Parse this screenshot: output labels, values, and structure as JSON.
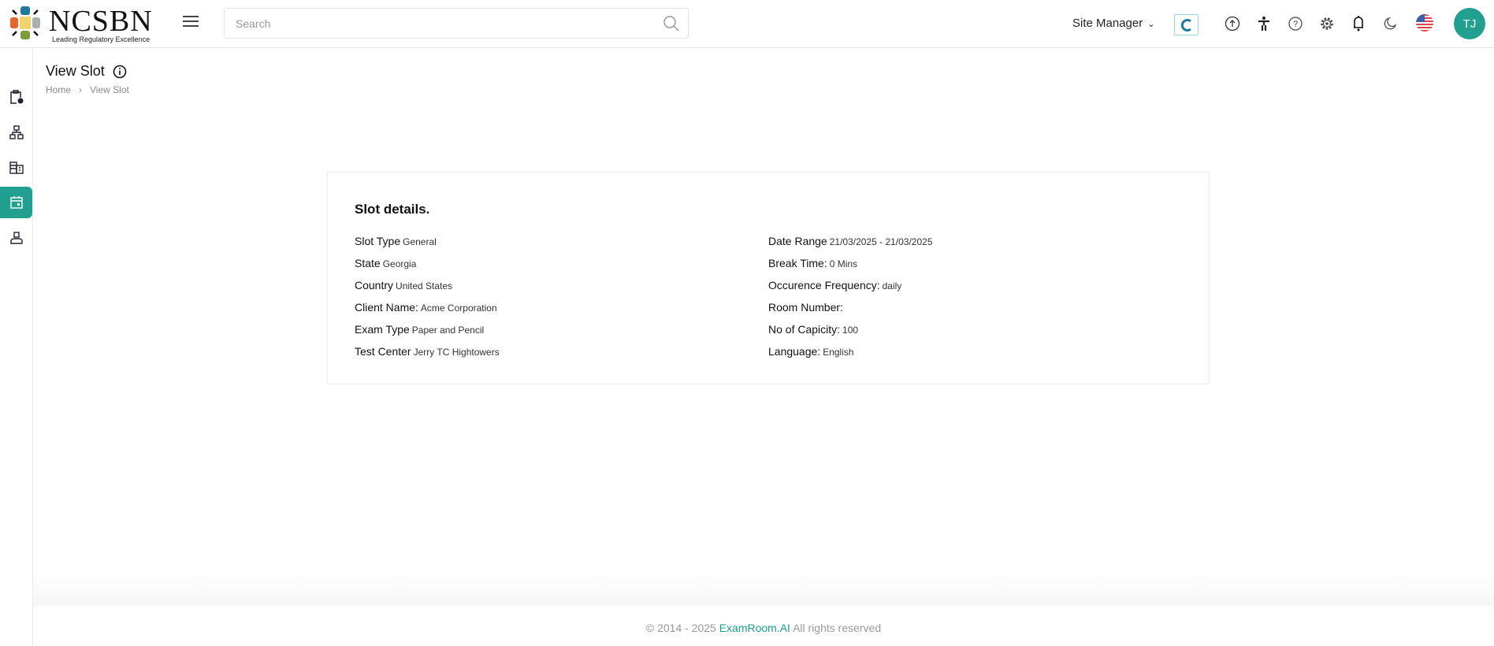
{
  "header": {
    "logo_text": "NCSBN",
    "logo_tagline": "Leading Regulatory Excellence",
    "search_placeholder": "Search",
    "role": "Site Manager",
    "avatar_initials": "TJ",
    "accent": "#22a08f"
  },
  "sidebar": {
    "items": [
      {
        "name": "clipboard-clock"
      },
      {
        "name": "sitemap"
      },
      {
        "name": "building"
      },
      {
        "name": "calendar",
        "active": true
      },
      {
        "name": "user-badge"
      }
    ]
  },
  "page": {
    "title": "View Slot",
    "breadcrumb": [
      "Home",
      "View Slot"
    ]
  },
  "card": {
    "title": "Slot details.",
    "left": [
      {
        "label": "Slot Type",
        "value": "General"
      },
      {
        "label": "State",
        "value": "Georgia"
      },
      {
        "label": "Country",
        "value": "United States"
      },
      {
        "label": "Client Name:",
        "value": "Acme Corporation"
      },
      {
        "label": "Exam Type",
        "value": "Paper and Pencil"
      },
      {
        "label": "Test Center",
        "value": "Jerry TC Hightowers"
      }
    ],
    "right": [
      {
        "label": "Date Range",
        "value": "21/03/2025 - 21/03/2025"
      },
      {
        "label": "Break Time:",
        "value": "0 Mins"
      },
      {
        "label": "Occurence Frequency:",
        "value": "daily"
      },
      {
        "label": "Room Number:",
        "value": ""
      },
      {
        "label": "No of Capicity:",
        "value": "100"
      },
      {
        "label": "Language:",
        "value": "English"
      }
    ]
  },
  "footer": {
    "prefix": "© 2014 - 2025",
    "brand": "ExamRoom.AI",
    "suffix": "All rights reserved"
  }
}
